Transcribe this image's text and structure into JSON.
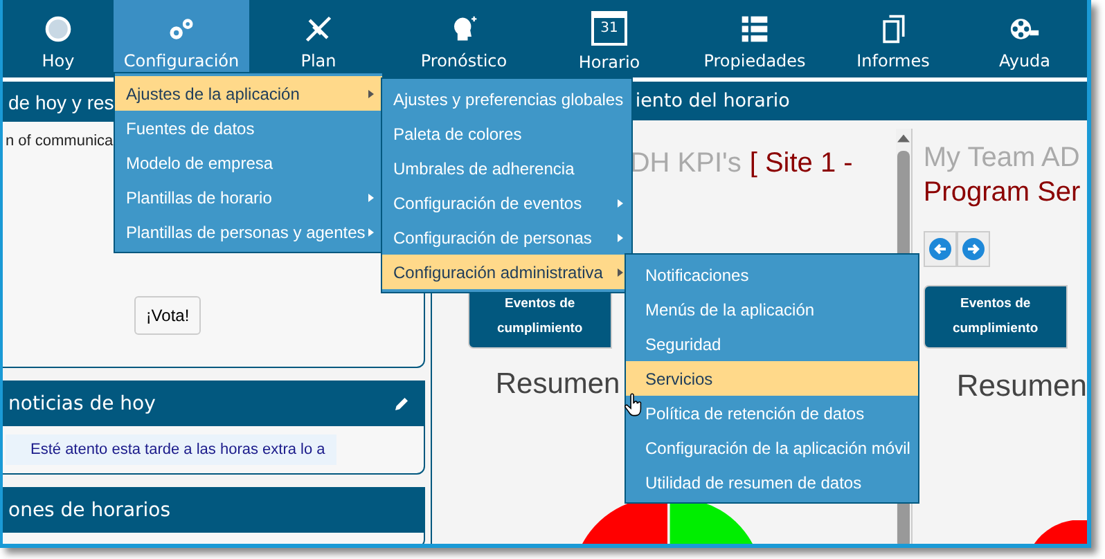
{
  "nav": [
    {
      "label": "Hoy",
      "selected": false
    },
    {
      "label": "Configuración",
      "selected": true
    },
    {
      "label": "Plan",
      "selected": false
    },
    {
      "label": "Pronóstico",
      "selected": false
    },
    {
      "label": "Horario",
      "selected": false,
      "icon_text": "31"
    },
    {
      "label": "Propiedades",
      "selected": false
    },
    {
      "label": "Informes",
      "selected": false
    },
    {
      "label": "Ayuda",
      "selected": false
    }
  ],
  "left": {
    "survey_title": "de hoy y res",
    "survey_text": "n of communica",
    "vote_button": "¡Vota!",
    "news_title": "noticias de hoy",
    "news_text": "Esté atento esta tarde a las horas extra lo a",
    "schedule_title": "ones de horarios"
  },
  "monitor": {
    "title": "iento del horario",
    "panel_a": {
      "title_gray": "DH KPI's",
      "title_red": "[ Site 1 -",
      "tab": "Eventos de cumplimiento",
      "summary": "Resumen"
    },
    "panel_b": {
      "title_gray": "My Team AD",
      "title_red": "Program Ser",
      "tab": "Eventos de cumplimiento",
      "summary": "Resumen"
    }
  },
  "menus": [
    {
      "items": [
        {
          "label": "Ajustes de la aplicación",
          "selected": true,
          "submenu": true
        },
        {
          "label": "Fuentes de datos",
          "selected": false,
          "submenu": false
        },
        {
          "label": "Modelo de empresa",
          "selected": false,
          "submenu": false
        },
        {
          "label": "Plantillas de horario",
          "selected": false,
          "submenu": true
        },
        {
          "label": "Plantillas de personas y agentes",
          "selected": false,
          "submenu": true
        }
      ]
    },
    {
      "items": [
        {
          "label": "Ajustes y preferencias globales",
          "selected": false,
          "submenu": false
        },
        {
          "label": "Paleta de colores",
          "selected": false,
          "submenu": false
        },
        {
          "label": "Umbrales de adherencia",
          "selected": false,
          "submenu": false
        },
        {
          "label": "Configuración de eventos",
          "selected": false,
          "submenu": true
        },
        {
          "label": "Configuración de personas",
          "selected": false,
          "submenu": true
        },
        {
          "label": "Configuración administrativa",
          "selected": true,
          "submenu": true
        }
      ]
    },
    {
      "items": [
        {
          "label": "Notificaciones",
          "selected": false,
          "submenu": false
        },
        {
          "label": "Menús de la aplicación",
          "selected": false,
          "submenu": false
        },
        {
          "label": "Seguridad",
          "selected": false,
          "submenu": false
        },
        {
          "label": "Servicios",
          "selected": true,
          "submenu": false
        },
        {
          "label": "Política de retención de datos",
          "selected": false,
          "submenu": false
        },
        {
          "label": "Configuración de la aplicación móvil",
          "selected": false,
          "submenu": false
        },
        {
          "label": "Utilidad de resumen de datos",
          "selected": false,
          "submenu": false
        }
      ]
    }
  ]
}
